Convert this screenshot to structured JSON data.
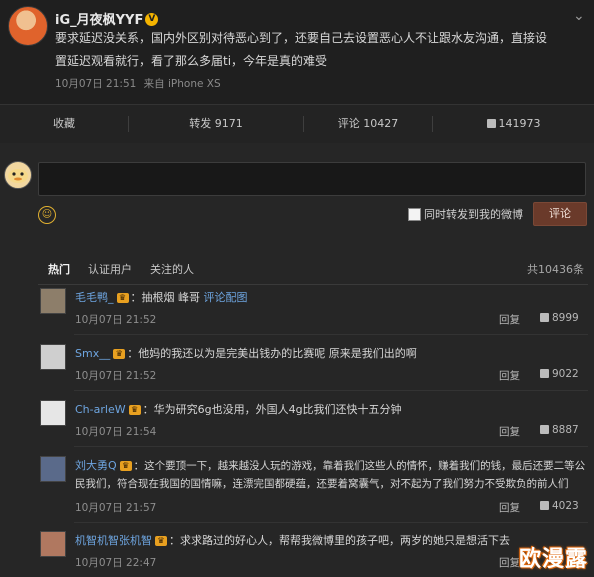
{
  "post": {
    "author": "iG_月夜枫YYF",
    "text_line1": "要求延迟没关系，国内外区别对待恶心到了，还要自己去设置恶心人不让跟水友沟通，直接设",
    "text_line2": "置延迟观看就行，看了那么多届ti，今年是真的难受",
    "time": "10月07日 21:51",
    "source": "来自 iPhone XS"
  },
  "actions": {
    "favorite": "收藏",
    "repost": "转发 9171",
    "comment": "评论 10427",
    "likes": "141973"
  },
  "composer": {
    "also_repost_label": "同时转发到我的微博",
    "submit_label": "评论"
  },
  "tabs": {
    "hot": "热门",
    "verified": "认证用户",
    "following": "关注的人",
    "total": "共10436条"
  },
  "comments": [
    {
      "name": "毛毛鸭_",
      "text": "：抽根烟 峰哥",
      "link": "评论配图",
      "time": "10月07日 21:52",
      "reply": "回复",
      "likes": "8999"
    },
    {
      "name": "Smx__",
      "text": "：他妈的我还以为是完美出钱办的比赛呢 原来是我们出的啊",
      "time": "10月07日 21:52",
      "reply": "回复",
      "likes": "9022"
    },
    {
      "name": "Ch-arleW",
      "text": "：华为研究6g也没用，外国人4g比我们还快十五分钟",
      "time": "10月07日 21:54",
      "reply": "回复",
      "likes": "8887"
    },
    {
      "name": "刘大勇Q",
      "text": "：这个要顶一下，越来越没人玩的游戏，靠着我们这些人的情怀，赚着我们的钱，最后还要二等公",
      "text2": "民我们，符合现在我国的国情嘛，连漂完国都硬蕴，还要着窝囊气，对不起为了我们努力不受欺负的前人们",
      "time": "10月07日 21:57",
      "reply": "回复",
      "likes": "4023"
    },
    {
      "name": "机智机智张机智",
      "text": "：求求路过的好心人，帮帮我微博里的孩子吧，两岁的她只是想活下去",
      "time": "10月07日 22:47",
      "reply": "回复"
    }
  ],
  "watermark": "欧漫露",
  "colors": {
    "link": "#6ea5e0",
    "crown": "#e8a020",
    "submit_bg": "#6a3a2a"
  }
}
